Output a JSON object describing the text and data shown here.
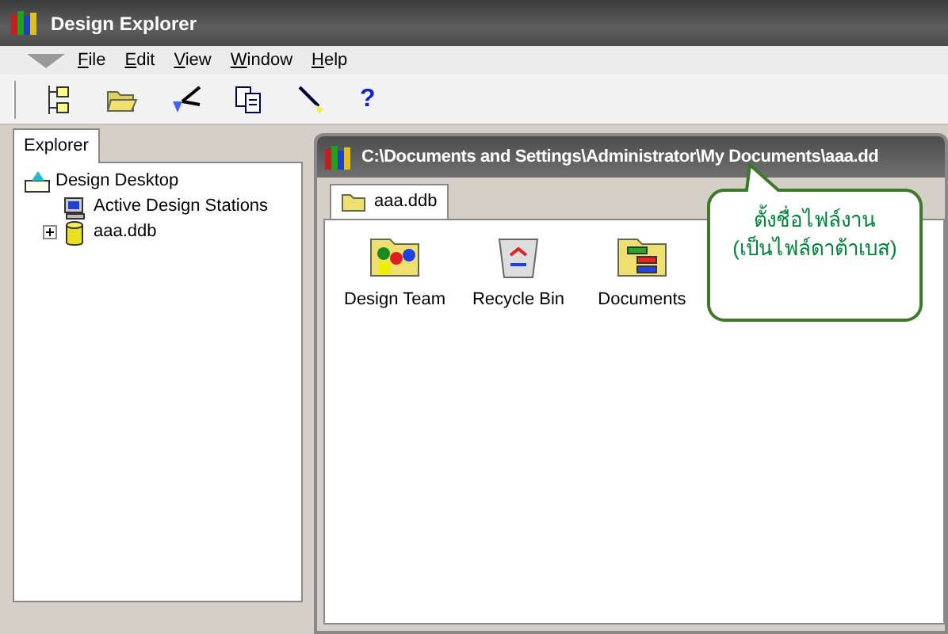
{
  "window": {
    "title": "Design Explorer"
  },
  "menu": [
    "File",
    "Edit",
    "View",
    "Window",
    "Help"
  ],
  "toolbar": [
    {
      "kind": "tree"
    },
    {
      "kind": "open"
    },
    {
      "kind": "cut"
    },
    {
      "kind": "copy"
    },
    {
      "kind": "paste"
    },
    {
      "kind": "help",
      "label": "?"
    }
  ],
  "explorer": {
    "tab": {
      "label": "Explorer",
      "selected": true
    },
    "tree": [
      {
        "label": "Design Desktop",
        "kind": "desktop",
        "children": [
          {
            "label": "Active Design Stations",
            "kind": "station"
          },
          {
            "label": "aaa.ddb",
            "kind": "database",
            "expanded": false
          }
        ]
      }
    ]
  },
  "document_window": {
    "title": "C:\\Documents and Settings\\Administrator\\My Documents\\aaa.dd",
    "tabs": [
      {
        "label": "aaa.ddb",
        "selected": true
      }
    ],
    "items": [
      {
        "label": "Design Team",
        "kind": "team"
      },
      {
        "label": "Recycle Bin",
        "kind": "recycle"
      },
      {
        "label": "Documents",
        "kind": "documents"
      }
    ]
  },
  "callout": {
    "lines": [
      "ตั้งชื่อไฟล์งาน",
      "(เป็นไฟล์ดาต้าเบส)"
    ]
  }
}
